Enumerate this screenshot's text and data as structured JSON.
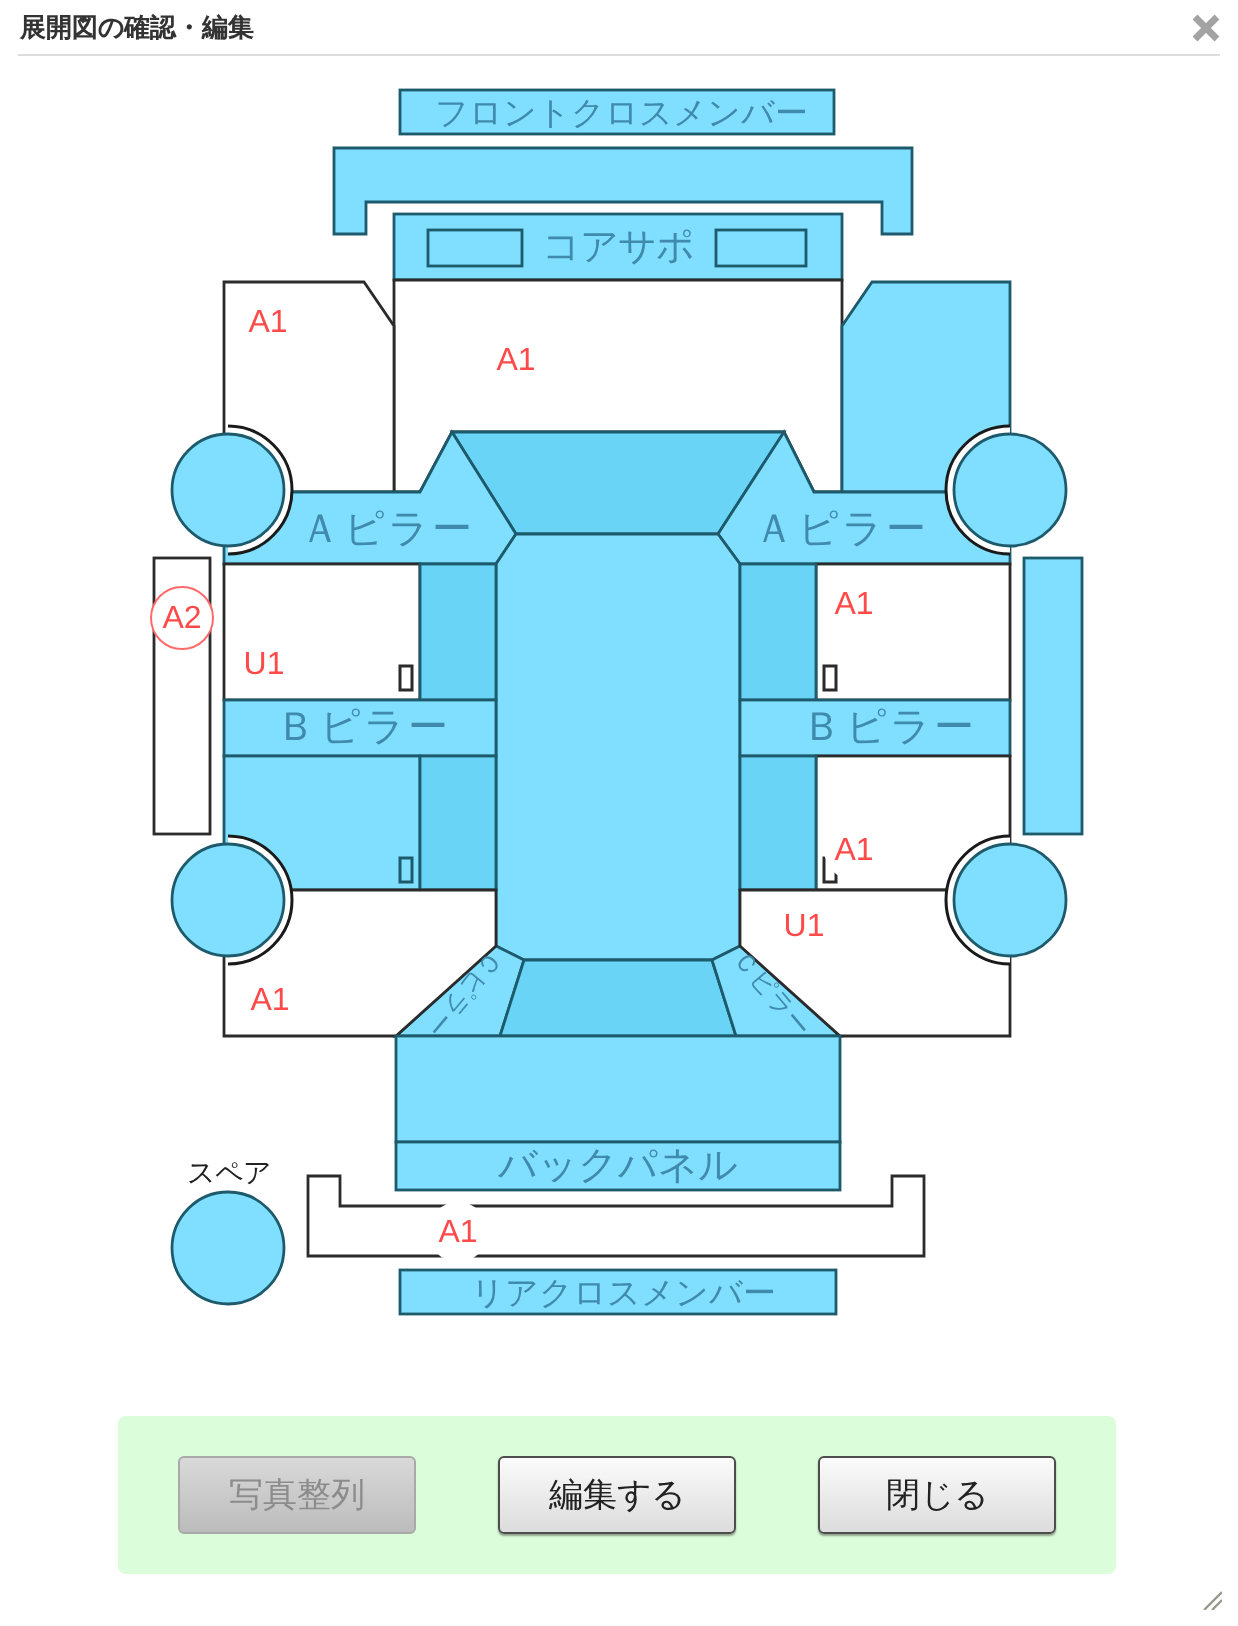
{
  "dialog": {
    "title": "展開図の確認・編集"
  },
  "diagram": {
    "parts": [
      {
        "kind": "panel",
        "label": "フロントクロスメンバー",
        "damaged": false
      },
      {
        "kind": "panel",
        "damaged": false
      },
      {
        "kind": "panel",
        "label": "コアサポ",
        "damaged": false
      },
      {
        "kind": "panel",
        "damaged": true,
        "codes": [
          {
            "text": "A1",
            "circled": false
          }
        ]
      },
      {
        "kind": "panel",
        "damaged": true,
        "codes": [
          {
            "text": "A1",
            "circled": false
          }
        ]
      },
      {
        "kind": "panel",
        "damaged": false
      },
      {
        "kind": "glass",
        "damaged": false
      },
      {
        "kind": "panel",
        "label": "Ａピラー",
        "damaged": false
      },
      {
        "kind": "panel",
        "label": "Ａピラー",
        "damaged": false
      },
      {
        "kind": "panel",
        "damaged": false
      },
      {
        "kind": "panel",
        "damaged": true,
        "codes": [
          {
            "text": "U1",
            "circled": false
          }
        ]
      },
      {
        "kind": "glass",
        "damaged": false
      },
      {
        "kind": "panel",
        "label": "Ｂピラー",
        "damaged": false
      },
      {
        "kind": "panel",
        "damaged": false
      },
      {
        "kind": "glass",
        "damaged": false
      },
      {
        "kind": "panel",
        "damaged": true,
        "codes": [
          {
            "text": "A1",
            "circled": false
          }
        ]
      },
      {
        "kind": "glass",
        "damaged": false
      },
      {
        "kind": "panel",
        "label": "Ｂピラー",
        "damaged": false
      },
      {
        "kind": "panel",
        "damaged": true,
        "codes": [
          {
            "text": "A1",
            "circled": false
          }
        ]
      },
      {
        "kind": "glass",
        "damaged": false
      },
      {
        "kind": "panel",
        "label": "Ｃピラー",
        "damaged": false
      },
      {
        "kind": "glass",
        "damaged": false
      },
      {
        "kind": "panel",
        "label": "Ｃピラー",
        "damaged": false
      },
      {
        "kind": "panel",
        "damaged": true,
        "codes": [
          {
            "text": "A1",
            "circled": false
          }
        ]
      },
      {
        "kind": "panel",
        "damaged": true,
        "codes": [
          {
            "text": "U1",
            "circled": false
          }
        ]
      },
      {
        "kind": "panel",
        "damaged": false
      },
      {
        "kind": "panel",
        "label": "バックパネル",
        "damaged": false
      },
      {
        "kind": "panel",
        "damaged": true,
        "codes": [
          {
            "text": "A2",
            "circled": true
          }
        ]
      },
      {
        "kind": "panel",
        "damaged": false
      },
      {
        "kind": "panel",
        "damaged": true,
        "codes": [
          {
            "text": "A1",
            "circled": false
          }
        ]
      },
      {
        "kind": "panel",
        "label": "リアクロスメンバー",
        "damaged": false
      }
    ],
    "spare": {
      "label": "スペア"
    }
  },
  "buttons": [
    {
      "label": "写真整列",
      "disabled": true
    },
    {
      "label": "編集する",
      "disabled": false
    },
    {
      "label": "閉じる",
      "disabled": false
    }
  ]
}
